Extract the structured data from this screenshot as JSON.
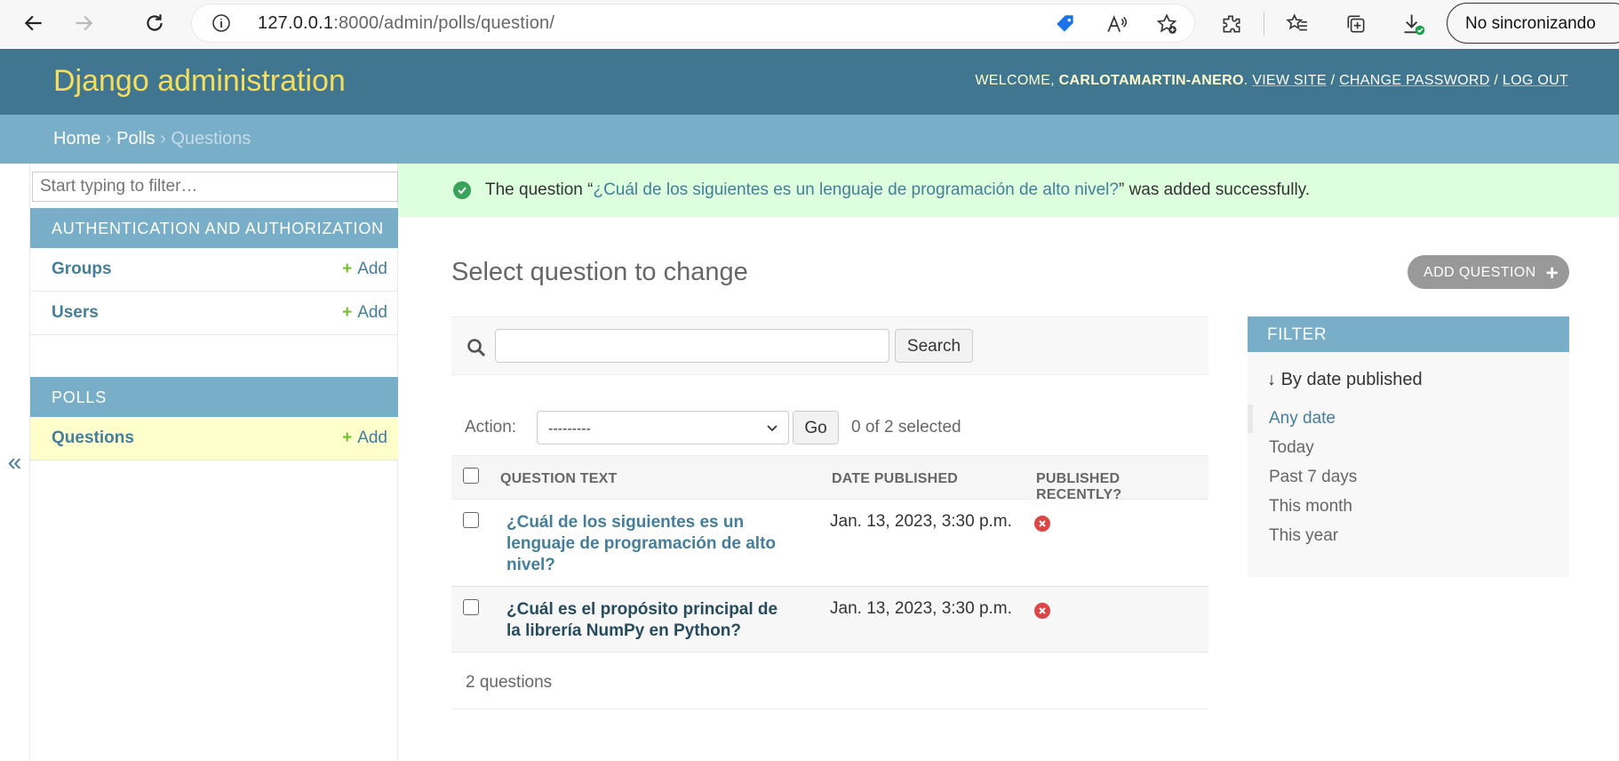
{
  "browser": {
    "url_host": "127.0.0.1",
    "url_rest": ":8000/admin/polls/question/",
    "sync_label": "No sincronizando"
  },
  "header": {
    "brand": "Django administration",
    "welcome": "Welcome,",
    "username": "carlotamartin-anero",
    "view_site": "View site",
    "change_password": "Change password",
    "log_out": "Log out",
    "sep": "/"
  },
  "breadcrumbs": {
    "home": "Home",
    "polls": "Polls",
    "current": "Questions",
    "sep": "›"
  },
  "sidebar": {
    "filter_placeholder": "Start typing to filter…",
    "modules": [
      {
        "caption": "Authentication and Authorization",
        "models": [
          {
            "name": "Groups",
            "add": "Add"
          },
          {
            "name": "Users",
            "add": "Add"
          }
        ]
      },
      {
        "caption": "Polls",
        "models": [
          {
            "name": "Questions",
            "add": "Add"
          }
        ]
      }
    ],
    "toggle": "«"
  },
  "message": {
    "prefix": "The question “",
    "link": "¿Cuál de los siguientes es un lenguaje de programación de alto nivel?",
    "suffix": "” was added successfully."
  },
  "main": {
    "title": "Select question to change",
    "add_button": "Add question",
    "search_button": "Search",
    "action_label": "Action:",
    "action_selected": "---------",
    "go_button": "Go",
    "selected_count": "0 of 2 selected",
    "columns": [
      "Question text",
      "Date published",
      "Published recently?"
    ],
    "rows": [
      {
        "question": "¿Cuál de los siguientes es un lenguaje de programación de alto nivel?",
        "date": "Jan. 13, 2023, 3:30 p.m.",
        "recent": false
      },
      {
        "question": "¿Cuál es el propósito principal de la librería NumPy en Python?",
        "date": "Jan. 13, 2023, 3:30 p.m.",
        "recent": false
      }
    ],
    "paginator": "2 questions"
  },
  "filter": {
    "caption": "Filter",
    "by": "By date published",
    "options": [
      "Any date",
      "Today",
      "Past 7 days",
      "This month",
      "This year"
    ],
    "selected": "Any date"
  },
  "colors": {
    "header_bg": "#417690",
    "breadcrumb_bg": "#79aec8",
    "brand": "#f5dd5d",
    "link": "#447e9b",
    "success_bg": "#ddffdd",
    "add_plus": "#70bf2b",
    "error_icon": "#dd4646"
  }
}
